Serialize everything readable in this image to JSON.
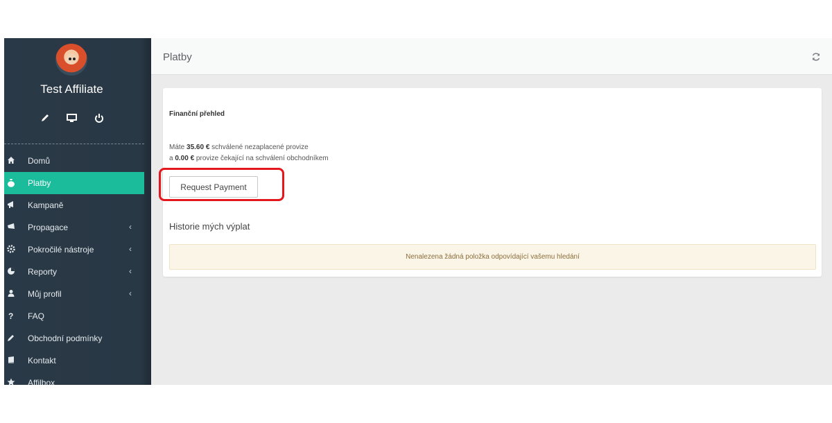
{
  "sidebar": {
    "user_name": "Test Affiliate",
    "user_actions": [
      "pencil-icon",
      "monitor-icon",
      "power-icon"
    ],
    "items": [
      {
        "label": "Domů",
        "icon": "home-icon",
        "active": false,
        "has_submenu": false
      },
      {
        "label": "Platby",
        "icon": "money-bag-icon",
        "active": true,
        "has_submenu": false
      },
      {
        "label": "Kampaně",
        "icon": "bullhorn-icon",
        "active": false,
        "has_submenu": false
      },
      {
        "label": "Propagace",
        "icon": "bullhorn-icon",
        "active": false,
        "has_submenu": true
      },
      {
        "label": "Pokročilé nástroje",
        "icon": "gear-icon",
        "active": false,
        "has_submenu": true
      },
      {
        "label": "Reporty",
        "icon": "pie-chart-icon",
        "active": false,
        "has_submenu": true
      },
      {
        "label": "Můj profil",
        "icon": "user-icon",
        "active": false,
        "has_submenu": true
      },
      {
        "label": "FAQ",
        "icon": "question-icon",
        "active": false,
        "has_submenu": false
      },
      {
        "label": "Obchodní podmínky",
        "icon": "pencil-icon",
        "active": false,
        "has_submenu": false
      },
      {
        "label": "Kontakt",
        "icon": "book-icon",
        "active": false,
        "has_submenu": false
      },
      {
        "label": "Affilbox",
        "icon": "star-icon",
        "active": false,
        "has_submenu": false
      }
    ],
    "caret": "‹"
  },
  "header": {
    "title": "Platby"
  },
  "overview": {
    "title": "Finanční přehled",
    "line1_prefix": "Máte ",
    "line1_amount": "35.60 €",
    "line1_suffix": " schválené nezaplacené provize",
    "line2_prefix": "a ",
    "line2_amount": "0.00 €",
    "line2_suffix": " provize čekající na schválení obchodníkem",
    "request_button": "Request Payment"
  },
  "history": {
    "title": "Historie mých výplat",
    "empty_message": "Nenalezena žádná položka odpovídající vašemu hledání"
  },
  "colors": {
    "accent": "#1abc9c",
    "sidebar_bg": "#2a3947",
    "highlight": "#e3171d",
    "empty_bg": "#fbf5e7"
  }
}
